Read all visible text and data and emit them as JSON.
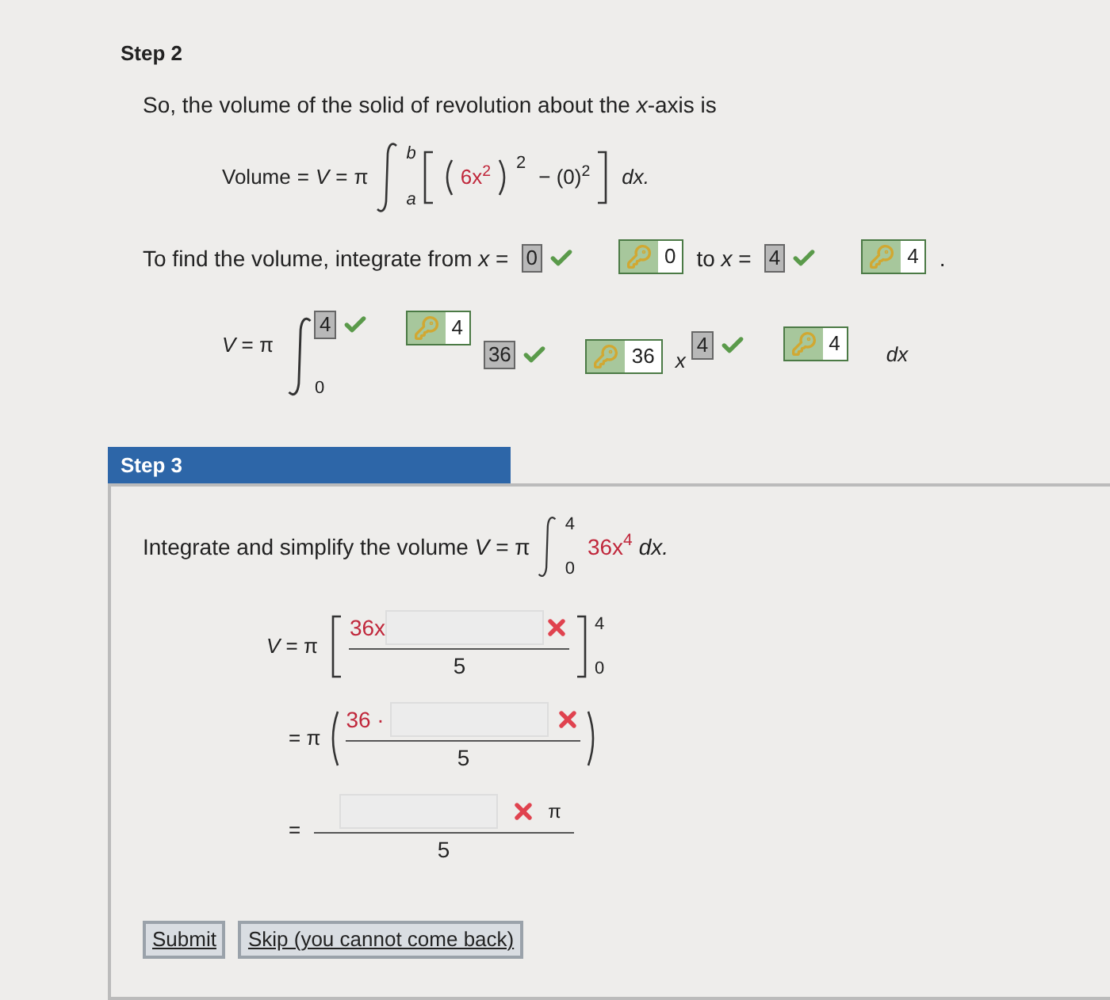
{
  "step2": {
    "title": "Step 2",
    "intro": "So, the volume of the solid of revolution about the *x*-axis is",
    "volume_formula": {
      "label": "Volume",
      "equals": "=",
      "lhs": "V",
      "equals2": "=",
      "pi": "π",
      "upper": "b",
      "lower": "a",
      "inner": "6x$^{2}$",
      "outer_exp": "2",
      "minus_term": "− (0)$^{2}$",
      "dx": "dx."
    },
    "bounds": {
      "text": "To find the volume, integrate from *x* =",
      "lower": {
        "value": "0",
        "correct": true,
        "key": "0"
      },
      "to": "to *x* =",
      "upper": {
        "value": "4",
        "correct": true,
        "key": "4"
      },
      "end": "."
    },
    "integral": {
      "lhs": "*V* = π",
      "lower_limit": "0",
      "upper": {
        "value": "4",
        "correct": true,
        "key": "4"
      },
      "coef": {
        "value": "36",
        "correct": true,
        "key": "36"
      },
      "var": "x",
      "exp": {
        "value": "4",
        "correct": true,
        "key": "4"
      },
      "dx": "dx"
    }
  },
  "step3": {
    "title": "Step 3",
    "prompt": "Integrate and simplify the volume *V* = π",
    "prompt_upper": "4",
    "prompt_lower": "0",
    "prompt_integrand": "36x$^{4}$",
    "prompt_dx": "dx.",
    "lines": [
      {
        "kind": "antiderivative",
        "lhs": "*V* = π",
        "numerator_prefix": "36x",
        "field": {
          "correct": false
        },
        "denominator": "5",
        "upper": "4",
        "lower": "0"
      },
      {
        "kind": "evaluate",
        "lhs": "= π",
        "numerator_prefix": "36 ·",
        "field": {
          "correct": false
        },
        "denominator": "5"
      },
      {
        "kind": "result",
        "lhs": "=",
        "field": {
          "correct": false
        },
        "suffix": "π",
        "denominator": "5"
      }
    ]
  },
  "buttons": [
    {
      "label": "Submit"
    },
    {
      "label": "Skip (you cannot come back)"
    }
  ]
}
